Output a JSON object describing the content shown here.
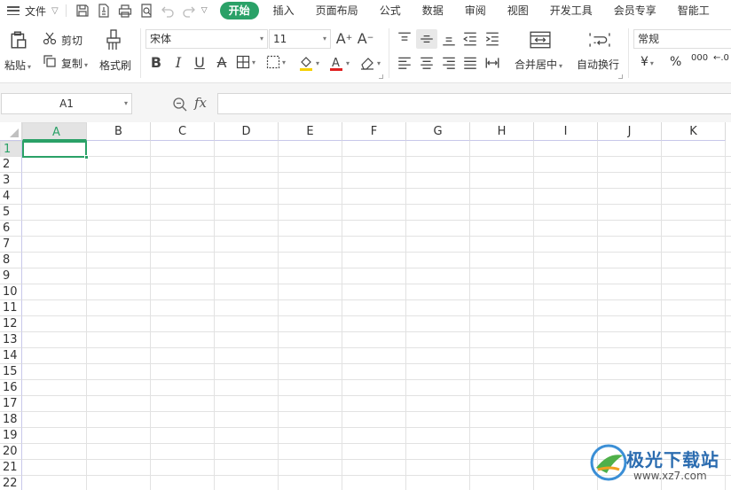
{
  "menubar": {
    "file_label": "文件",
    "tabs": [
      {
        "label": "开始",
        "active": true
      },
      {
        "label": "插入",
        "active": false
      },
      {
        "label": "页面布局",
        "active": false
      },
      {
        "label": "公式",
        "active": false
      },
      {
        "label": "数据",
        "active": false
      },
      {
        "label": "审阅",
        "active": false
      },
      {
        "label": "视图",
        "active": false
      },
      {
        "label": "开发工具",
        "active": false
      },
      {
        "label": "会员专享",
        "active": false
      },
      {
        "label": "智能工",
        "active": false
      }
    ]
  },
  "ribbon": {
    "paste_label": "粘贴",
    "cut_label": "剪切",
    "copy_label": "复制",
    "format_painter_label": "格式刷",
    "font_name": "宋体",
    "font_size": "11",
    "merge_center_label": "合并居中",
    "wrap_text_label": "自动换行",
    "number_format": "常规",
    "percent_symbol": "%",
    "thousands_symbol": "000",
    "decimal_symbol": "←.0",
    "currency_symbol": "¥"
  },
  "formula_bar": {
    "cell_ref": "A1",
    "fx_label": "fx",
    "formula_value": ""
  },
  "grid": {
    "columns": [
      "A",
      "B",
      "C",
      "D",
      "E",
      "F",
      "G",
      "H",
      "I",
      "J",
      "K"
    ],
    "rows": [
      "1",
      "2",
      "3",
      "4",
      "5",
      "6",
      "7",
      "8",
      "9",
      "10",
      "11",
      "12",
      "13",
      "14",
      "15",
      "16",
      "17",
      "18",
      "19",
      "20",
      "21",
      "22"
    ],
    "selected_column": "A",
    "selected_row": "1"
  },
  "watermark": {
    "name": "极光下载站",
    "url": "www.xz7.com"
  },
  "colors": {
    "accent": "#2aa167",
    "watermark_blue": "#2b6cb0"
  }
}
